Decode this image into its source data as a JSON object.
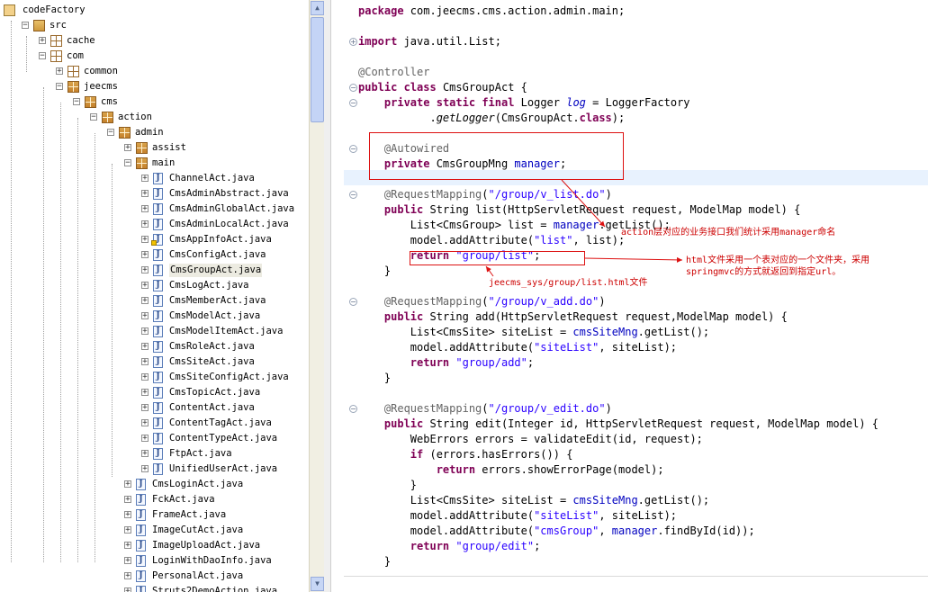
{
  "tree": {
    "items": [
      {
        "label": "codeFactory",
        "icon": "project-icon"
      },
      {
        "label": "src",
        "icon": "source-folder-icon"
      },
      {
        "label": "cache",
        "icon": "package-icon"
      },
      {
        "label": "com",
        "icon": "package-icon"
      },
      {
        "label": "common",
        "icon": "package-icon"
      },
      {
        "label": "jeecms",
        "icon": "package-icon"
      },
      {
        "label": "cms",
        "icon": "package-icon"
      },
      {
        "label": "action",
        "icon": "package-icon"
      },
      {
        "label": "admin",
        "icon": "package-icon"
      },
      {
        "label": "assist",
        "icon": "package-icon"
      },
      {
        "label": "main",
        "icon": "package-icon"
      },
      {
        "label": "ChannelAct.java",
        "icon": "java-file-icon"
      },
      {
        "label": "CmsAdminAbstract.java",
        "icon": "java-file-icon"
      },
      {
        "label": "CmsAdminGlobalAct.java",
        "icon": "java-file-icon"
      },
      {
        "label": "CmsAdminLocalAct.java",
        "icon": "java-file-icon"
      },
      {
        "label": "CmsAppInfoAct.java",
        "icon": "java-file-icon"
      },
      {
        "label": "CmsConfigAct.java",
        "icon": "java-file-icon"
      },
      {
        "label": "CmsGroupAct.java",
        "icon": "java-file-icon"
      },
      {
        "label": "CmsLogAct.java",
        "icon": "java-file-icon"
      },
      {
        "label": "CmsMemberAct.java",
        "icon": "java-file-icon"
      },
      {
        "label": "CmsModelAct.java",
        "icon": "java-file-icon"
      },
      {
        "label": "CmsModelItemAct.java",
        "icon": "java-file-icon"
      },
      {
        "label": "CmsRoleAct.java",
        "icon": "java-file-icon"
      },
      {
        "label": "CmsSiteAct.java",
        "icon": "java-file-icon"
      },
      {
        "label": "CmsSiteConfigAct.java",
        "icon": "java-file-icon"
      },
      {
        "label": "CmsTopicAct.java",
        "icon": "java-file-icon"
      },
      {
        "label": "ContentAct.java",
        "icon": "java-file-icon"
      },
      {
        "label": "ContentTagAct.java",
        "icon": "java-file-icon"
      },
      {
        "label": "ContentTypeAct.java",
        "icon": "java-file-icon"
      },
      {
        "label": "FtpAct.java",
        "icon": "java-file-icon"
      },
      {
        "label": "UnifiedUserAct.java",
        "icon": "java-file-icon"
      },
      {
        "label": "CmsLoginAct.java",
        "icon": "java-file-icon"
      },
      {
        "label": "FckAct.java",
        "icon": "java-file-icon"
      },
      {
        "label": "FrameAct.java",
        "icon": "java-file-icon"
      },
      {
        "label": "ImageCutAct.java",
        "icon": "java-file-icon"
      },
      {
        "label": "ImageUploadAct.java",
        "icon": "java-file-icon"
      },
      {
        "label": "LoginWithDaoInfo.java",
        "icon": "java-file-icon"
      },
      {
        "label": "PersonalAct.java",
        "icon": "java-file-icon"
      },
      {
        "label": "Struts2DemoAction.java",
        "icon": "java-file-icon"
      }
    ],
    "selected": "CmsGroupAct.java"
  },
  "editor": {
    "lines": [
      "package com.jeecms.cms.action.admin.main;",
      "",
      "import java.util.List;",
      "",
      "@Controller",
      "public class CmsGroupAct {",
      "    private static final Logger log = LoggerFactory",
      "            .getLogger(CmsGroupAct.class);",
      "",
      "    @Autowired",
      "    private CmsGroupMng manager;",
      "",
      "    @RequestMapping(\"/group/v_list.do\")",
      "    public String list(HttpServletRequest request, ModelMap model) {",
      "        List<CmsGroup> list = manager.getList();",
      "        model.addAttribute(\"list\", list);",
      "        return \"group/list\";",
      "    }",
      "",
      "    @RequestMapping(\"/group/v_add.do\")",
      "    public String add(HttpServletRequest request,ModelMap model) {",
      "        List<CmsSite> siteList = cmsSiteMng.getList();",
      "        model.addAttribute(\"siteList\", siteList);",
      "        return \"group/add\";",
      "    }",
      "",
      "    @RequestMapping(\"/group/v_edit.do\")",
      "    public String edit(Integer id, HttpServletRequest request, ModelMap model) {",
      "        WebErrors errors = validateEdit(id, request);",
      "        if (errors.hasErrors()) {",
      "            return errors.showErrorPage(model);",
      "        }",
      "        List<CmsSite> siteList = cmsSiteMng.getList();",
      "        model.addAttribute(\"siteList\", siteList);",
      "        model.addAttribute(\"cmsGroup\", manager.findById(id));",
      "        return \"group/edit\";",
      "    }"
    ]
  },
  "annotations": {
    "note_manager": "action层对应的业务接口我们统计采用manager命名",
    "note_html_1": "html文件采用一个表对应的一个文件夹，采用",
    "note_html_2": "springmvc的方式就返回到指定url。",
    "note_listfile": "jeecms_sys/group/list.html文件"
  },
  "colors": {
    "keyword": "#7f0055",
    "string": "#2a00ff",
    "annotation": "#646464",
    "field": "#0000c0",
    "note_red": "#cc0000",
    "current_line": "#e8f2fe"
  }
}
